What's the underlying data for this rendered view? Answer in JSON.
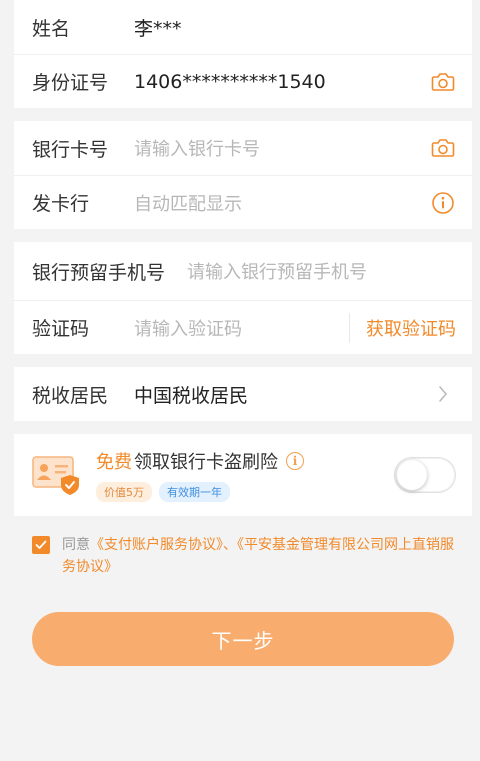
{
  "identity": {
    "name_label": "姓名",
    "name_value": "李***",
    "id_label": "身份证号",
    "id_value": "1406**********1540",
    "id_scan_icon": "camera-icon"
  },
  "bank": {
    "card_label": "银行卡号",
    "card_placeholder": "请输入银行卡号",
    "card_scan_icon": "camera-icon",
    "issuer_label": "发卡行",
    "issuer_placeholder": "自动匹配显示",
    "issuer_info_icon": "info-icon"
  },
  "phone": {
    "phone_label": "银行预留手机号",
    "phone_placeholder": "请输入银行预留手机号",
    "code_label": "验证码",
    "code_placeholder": "请输入验证码",
    "get_code": "获取验证码"
  },
  "tax": {
    "label": "税收居民",
    "value": "中国税收居民",
    "chevron_icon": "chevron-right-icon"
  },
  "insurance": {
    "free": "免费",
    "title": "领取银行卡盗刷险",
    "info_mark": "i",
    "badge_value": "价值5万",
    "badge_valid": "有效期一年",
    "enabled": false
  },
  "agreement": {
    "checked": true,
    "prefix": "同意",
    "doc1": "《支付账户服务协议》",
    "sep": "、",
    "doc2": "《平安基金管理有限公司网上直销服务协议》"
  },
  "next_button": "下一步",
  "colors": {
    "accent": "#f28a2a",
    "button": "#f8ad6e",
    "placeholder": "#b7b7b7",
    "background": "#f3f3f3"
  }
}
